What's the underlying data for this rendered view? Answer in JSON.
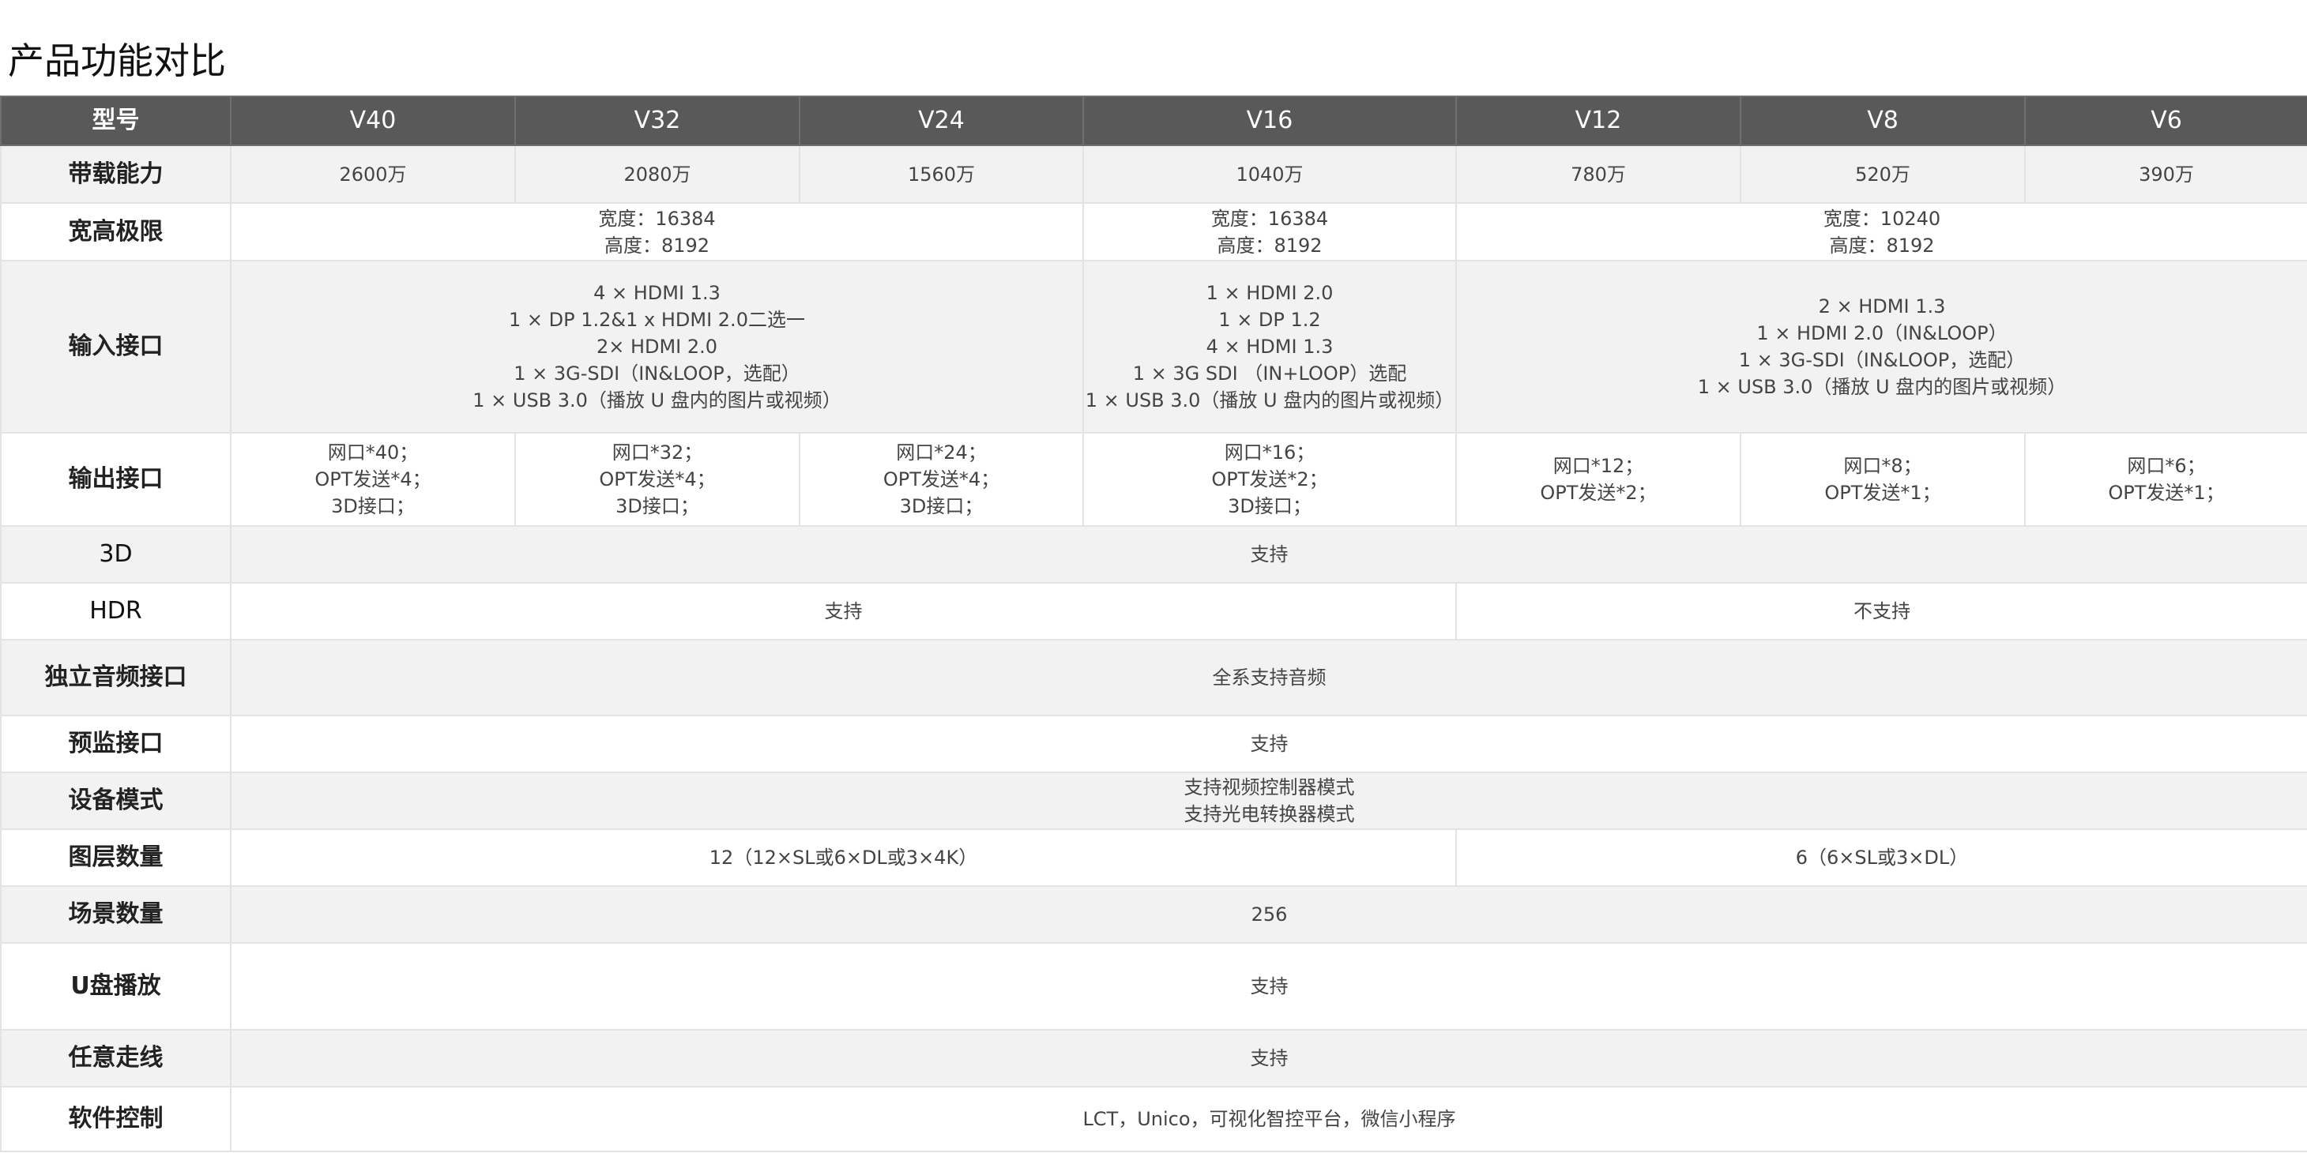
{
  "page": {
    "title": "产品功能对比"
  },
  "table": {
    "header": {
      "corner": "型号",
      "models": [
        "V40",
        "V32",
        "V24",
        "V16",
        "V12",
        "V8",
        "V6"
      ]
    },
    "rows": {
      "capacity": {
        "label": "带载能力",
        "v40": "2600万",
        "v32": "2080万",
        "v24": "1560万",
        "v16": "1040万",
        "v12": "780万",
        "v8": "520万",
        "v6": "390万"
      },
      "resolution": {
        "label": "宽高极限",
        "group_v40_v24": "宽度：16384\n高度：8192",
        "group_v16": "宽度：16384\n高度：8192",
        "group_v12_v6": "宽度：10240\n高度：8192"
      },
      "input": {
        "label": "输入接口",
        "group_v40_v24": "4 × HDMI 1.3\n1 × DP 1.2&1 x HDMI 2.0二选一\n2× HDMI 2.0\n1 × 3G-SDI（IN&LOOP，选配）\n1 × USB 3.0（播放 U 盘内的图片或视频）",
        "group_v16": "1 × HDMI 2.0\n1 × DP 1.2\n4 × HDMI 1.3\n1 × 3G SDI （IN+LOOP）选配\n1 × USB 3.0（播放 U 盘内的图片或视频）",
        "group_v12_v6": "2 × HDMI 1.3\n1 × HDMI 2.0（IN&LOOP）\n1 × 3G-SDI（IN&LOOP，选配）\n1 × USB 3.0（播放 U 盘内的图片或视频）"
      },
      "output": {
        "label": "输出接口",
        "v40": "网口*40；\nOPT发送*4；\n3D接口；",
        "v32": "网口*32；\nOPT发送*4；\n3D接口；",
        "v24": "网口*24；\nOPT发送*4；\n3D接口；",
        "v16": "网口*16；\nOPT发送*2；\n3D接口；",
        "v12": "网口*12；\nOPT发送*2；",
        "v8": "网口*8；\nOPT发送*1；",
        "v6": "网口*6；\nOPT发送*1；"
      },
      "three_d": {
        "label": "3D",
        "all": "支持"
      },
      "hdr": {
        "label": "HDR",
        "group_v40_v16": "支持",
        "group_v12_v6": "不支持"
      },
      "audio": {
        "label": "独立音频接口",
        "all": "全系支持音频"
      },
      "preview": {
        "label": "预监接口",
        "all": "支持"
      },
      "device_mode": {
        "label": "设备模式",
        "all": "支持视频控制器模式\n支持光电转换器模式"
      },
      "layers": {
        "label": "图层数量",
        "group_v40_v16": "12（12×SL或6×DL或3×4K）",
        "group_v12_v6": "6（6×SL或3×DL）"
      },
      "scenes": {
        "label": "场景数量",
        "all": "256"
      },
      "usb_playback": {
        "label": "U盘播放",
        "all": "支持"
      },
      "routing": {
        "label": "任意走线",
        "all": "支持"
      },
      "software": {
        "label": "软件控制",
        "all": "LCT，Unico，可视化智控平台，微信小程序"
      }
    }
  }
}
